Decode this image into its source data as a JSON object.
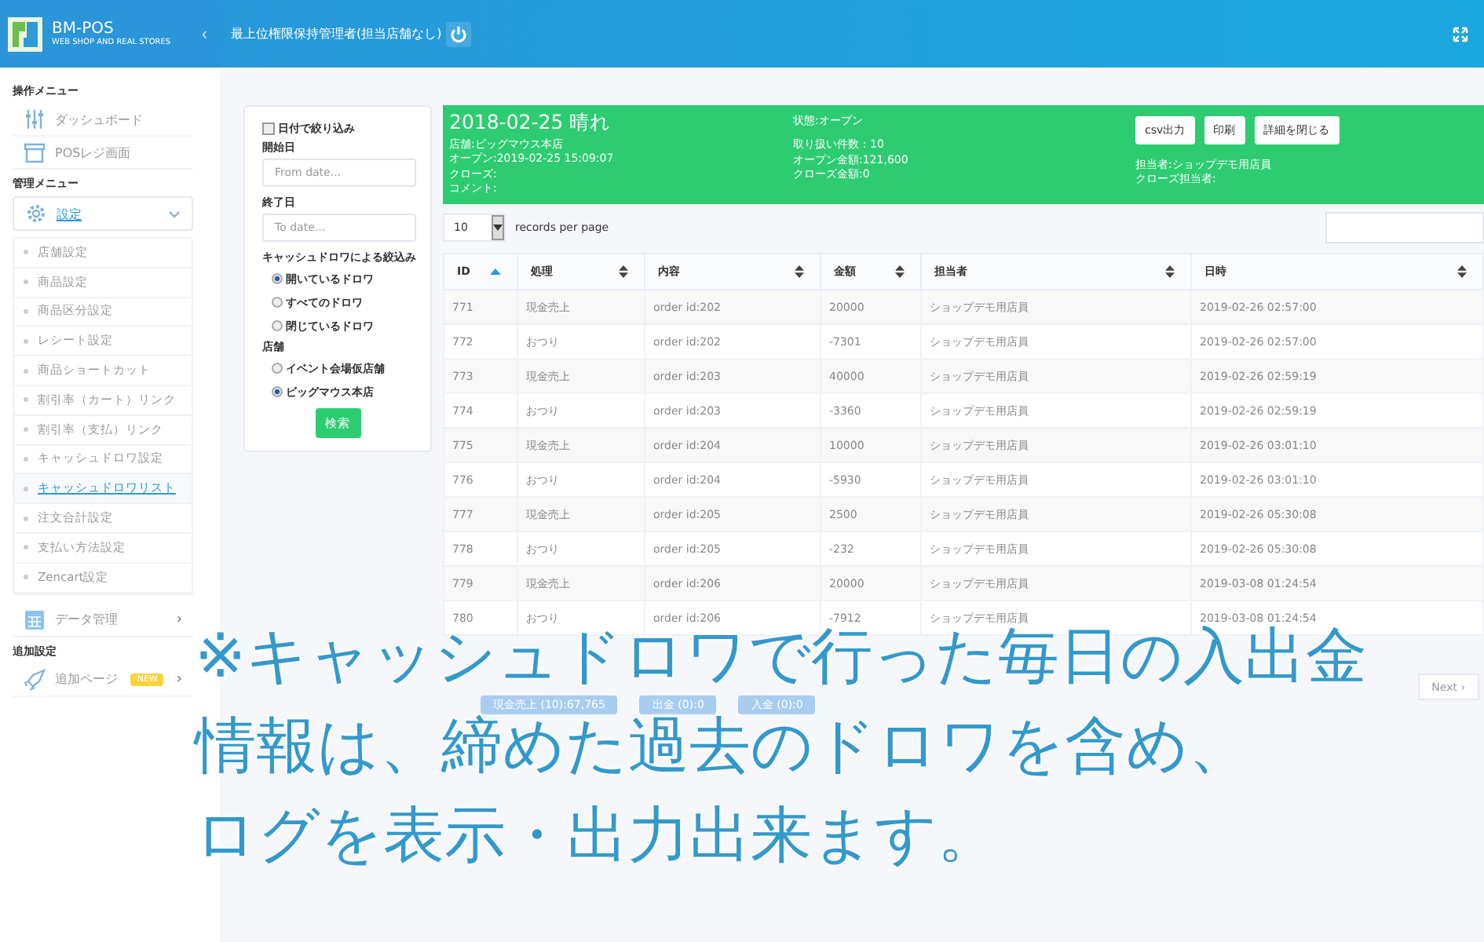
{
  "header": {
    "brand": "BM-POS",
    "tagline": "WEB SHOP AND REAL STORES",
    "collapse": "‹",
    "user": "最上位権限保持管理者(担当店舗なし)"
  },
  "sidebar": {
    "sections": [
      {
        "heading": "操作メニュー",
        "items": [
          {
            "label": "ダッシュボード",
            "kind": "sliders",
            "expanded": false
          },
          {
            "label": "POSレジ画面",
            "kind": "store",
            "expanded": false
          }
        ]
      },
      {
        "heading": "管理メニュー",
        "items": [
          {
            "label": "設定",
            "kind": "gear",
            "expanded": true,
            "children": [
              {
                "label": "店舗設定",
                "selected": false
              },
              {
                "label": "商品設定",
                "selected": false
              },
              {
                "label": "商品区分設定",
                "selected": false
              },
              {
                "label": "レシート設定",
                "selected": false
              },
              {
                "label": "商品ショートカット",
                "selected": false
              },
              {
                "label": "割引率（カート）リンク",
                "selected": false
              },
              {
                "label": "割引率（支払）リンク",
                "selected": false
              },
              {
                "label": "キャッシュドロワ設定",
                "selected": false
              },
              {
                "label": "キャッシュドロワリスト",
                "selected": true
              },
              {
                "label": "注文合計設定",
                "selected": false
              },
              {
                "label": "支払い方法設定",
                "selected": false
              },
              {
                "label": "Zencart設定",
                "selected": false
              }
            ]
          },
          {
            "label": "データ管理",
            "kind": "grid",
            "expanded": false,
            "chevron": "›"
          }
        ]
      },
      {
        "heading": "追加設定",
        "items": [
          {
            "label": "追加ページ",
            "kind": "rocket",
            "badge": "NEW",
            "expanded": false,
            "chevron": "›"
          }
        ]
      }
    ]
  },
  "filter": {
    "date_filter": {
      "label": "日付で絞り込み",
      "checked": false
    },
    "start_label": "開始日",
    "start_placeholder": "From date...",
    "end_label": "終了日",
    "end_placeholder": "To date...",
    "drawer_label": "キャッシュドロワによる絞込み",
    "drawer_options": [
      {
        "label": "開いているドロワ",
        "selected": true
      },
      {
        "label": "すべてのドロワ",
        "selected": false
      },
      {
        "label": "閉じているドロワ",
        "selected": false
      }
    ],
    "store_label": "店舗",
    "store_options": [
      {
        "label": "イベント会場仮店舗",
        "selected": false
      },
      {
        "label": "ビッグマウス本店",
        "selected": true
      }
    ],
    "search_button": "検索"
  },
  "detail": {
    "title": "2018-02-25 晴れ",
    "col1": [
      "店舗:ビッグマウス本店",
      "オープン:2019-02-25 15:09:07",
      "クローズ:",
      "コメント:"
    ],
    "col2_top": "状態:オープン",
    "col2": [
      "取り扱い件数：10",
      "オープン金額:121,600",
      "クローズ金額:0"
    ],
    "buttons": [
      "csv出力",
      "印刷",
      "詳細を閉じる"
    ],
    "col3": [
      "担当者:ショップデモ用店員",
      "クローズ担当者:"
    ]
  },
  "page_size": {
    "value": "10",
    "label": "records per page"
  },
  "table": {
    "columns": [
      {
        "label": "ID",
        "sorted": true
      },
      {
        "label": "処理",
        "sorted": false
      },
      {
        "label": "内容",
        "sorted": false
      },
      {
        "label": "金額",
        "sorted": false
      },
      {
        "label": "担当者",
        "sorted": false
      },
      {
        "label": "日時",
        "sorted": false
      }
    ],
    "rows": [
      [
        "771",
        "現金売上",
        "order id:202",
        "20000",
        "ショップデモ用店員",
        "2019-02-26 02:57:00"
      ],
      [
        "772",
        "おつり",
        "order id:202",
        "-7301",
        "ショップデモ用店員",
        "2019-02-26 02:57:00"
      ],
      [
        "773",
        "現金売上",
        "order id:203",
        "40000",
        "ショップデモ用店員",
        "2019-02-26 02:59:19"
      ],
      [
        "774",
        "おつり",
        "order id:203",
        "-3360",
        "ショップデモ用店員",
        "2019-02-26 02:59:19"
      ],
      [
        "775",
        "現金売上",
        "order id:204",
        "10000",
        "ショップデモ用店員",
        "2019-02-26 03:01:10"
      ],
      [
        "776",
        "おつり",
        "order id:204",
        "-5930",
        "ショップデモ用店員",
        "2019-02-26 03:01:10"
      ],
      [
        "777",
        "現金売上",
        "order id:205",
        "2500",
        "ショップデモ用店員",
        "2019-02-26 05:30:08"
      ],
      [
        "778",
        "おつり",
        "order id:205",
        "-232",
        "ショップデモ用店員",
        "2019-02-26 05:30:08"
      ],
      [
        "779",
        "現金売上",
        "order id:206",
        "20000",
        "ショップデモ用店員",
        "2019-03-08 01:24:54"
      ],
      [
        "780",
        "おつり",
        "order id:206",
        "-7912",
        "ショップデモ用店員",
        "2019-03-08 01:24:54"
      ]
    ]
  },
  "totals": [
    "現金売上 (10):67,765",
    "出金 (0):0",
    "入金 (0):0"
  ],
  "pagination": {
    "next": "Next ›"
  },
  "caption": [
    "※キャッシュドロワで行った毎日の入出金",
    "情報は、締めた過去のドロワを含め、",
    "ログを表示・出力出来ます。"
  ]
}
